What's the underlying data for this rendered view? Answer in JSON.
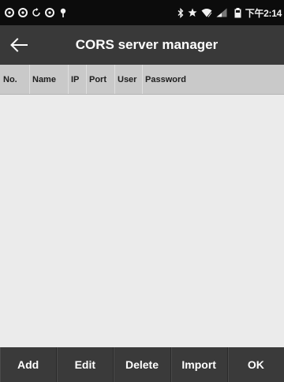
{
  "status_bar": {
    "left_icons": [
      "notification-icon",
      "notification-icon",
      "sync-icon",
      "notification-icon",
      "location-pin-icon"
    ],
    "right_icons": [
      "bluetooth-icon",
      "star-icon",
      "wifi-icon",
      "signal-icon",
      "battery-icon"
    ],
    "time": "下午2:14"
  },
  "app_bar": {
    "title": "CORS server manager",
    "back_icon": "arrow-left-icon"
  },
  "table": {
    "columns": [
      "No.",
      "Name",
      "IP",
      "Port",
      "User",
      "Password"
    ],
    "rows": []
  },
  "toolbar": {
    "add_label": "Add",
    "edit_label": "Edit",
    "delete_label": "Delete",
    "import_label": "Import",
    "ok_label": "OK"
  },
  "colors": {
    "status_bar_bg": "#0c0c0c",
    "app_bar_bg": "#393939",
    "table_header_bg": "#c9c9c9",
    "body_bg": "#ebebeb",
    "toolbar_bg": "#3a3a3a"
  }
}
